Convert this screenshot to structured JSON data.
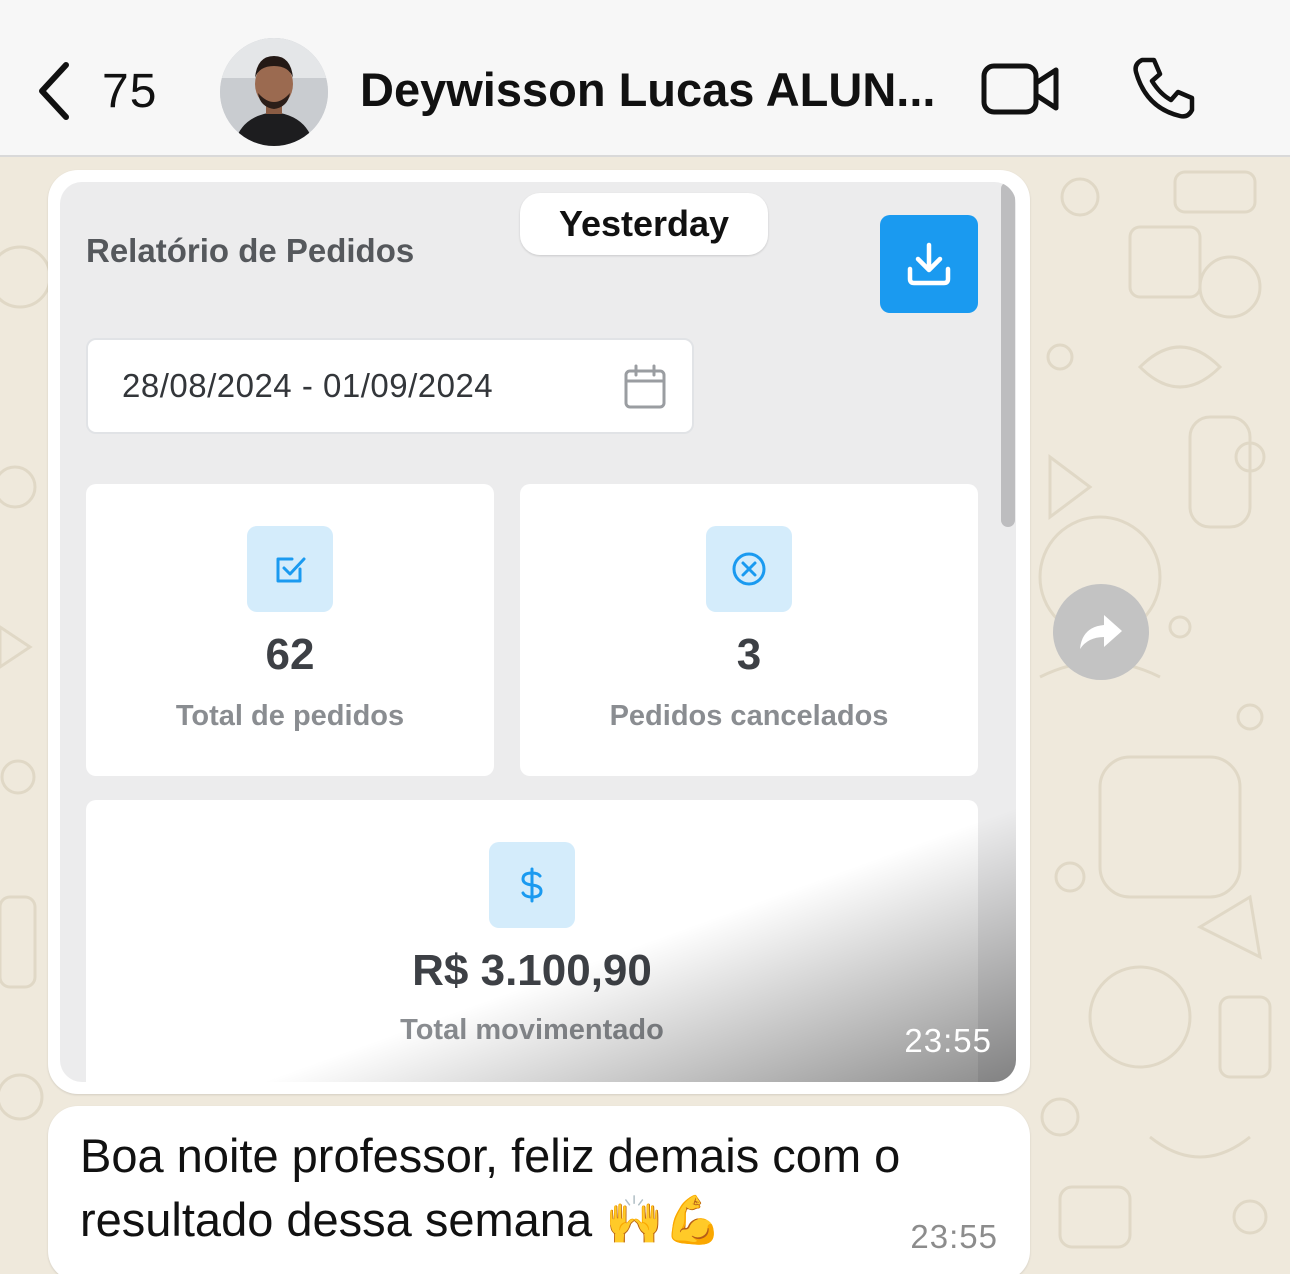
{
  "header": {
    "back_count": "75",
    "contact_name": "Deywisson Lucas ALUN..."
  },
  "chat": {
    "date_chip": "Yesterday",
    "image_message": {
      "time": "23:55",
      "report": {
        "title": "Relatório de Pedidos",
        "date_range": "28/08/2024 - 01/09/2024",
        "cards": [
          {
            "value": "62",
            "label": "Total de pedidos",
            "icon": "check-square-icon"
          },
          {
            "value": "3",
            "label": "Pedidos cancelados",
            "icon": "x-circle-icon"
          },
          {
            "value": "R$ 3.100,90",
            "label": "Total movimentado",
            "icon": "dollar-icon"
          }
        ],
        "accent_color": "#1a9af0"
      }
    },
    "text_message": {
      "text": "Boa noite professor, feliz demais com o resultado dessa semana",
      "emojis": "🙌💪",
      "time": "23:55"
    }
  }
}
